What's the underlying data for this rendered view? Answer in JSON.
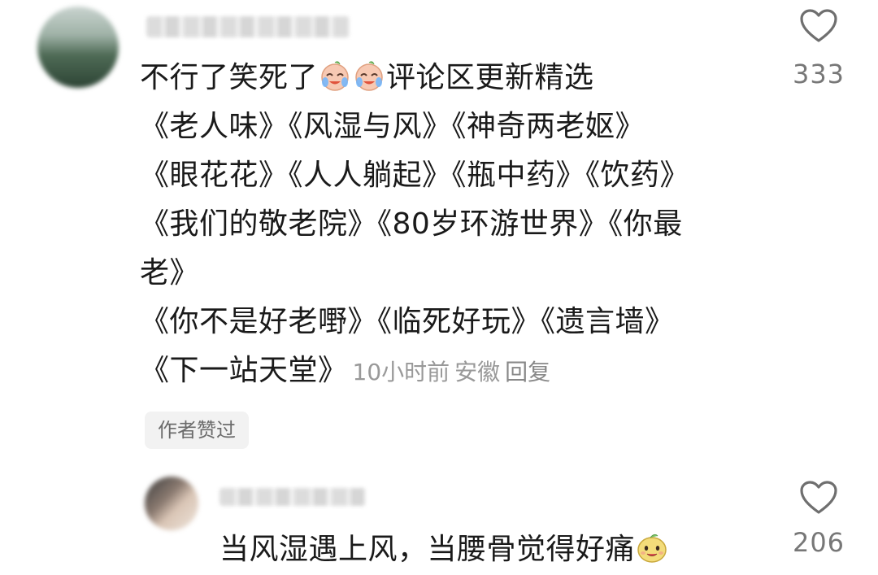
{
  "main_comment": {
    "username_blurred": "",
    "lines": [
      {
        "text": "不行了笑死了",
        "emoji": "crying-laughing-face-emoji",
        "tail": "评论区更新精选"
      },
      {
        "text": "《老人味》《风湿与风》《神奇两老妪》"
      },
      {
        "text": "《眼花花》《人人躺起》《瓶中药》《饮药》"
      },
      {
        "text": "《我们的敬老院》《80岁环游世界》《你最"
      },
      {
        "text": "老》"
      },
      {
        "text": "《你不是好老嘢》《临死好玩》《遗言墙》"
      },
      {
        "text": "《下一站天堂》"
      }
    ],
    "time": "10小时前",
    "location": "安徽",
    "reply_label": "回复",
    "author_liked_label": "作者赞过",
    "like_count": "333"
  },
  "reply_comment": {
    "text": "当风湿遇上风，当腰骨觉得好痛",
    "emoji": "smiling-bean-emoji",
    "like_count": "206"
  },
  "colors": {
    "text": "#1a1a1a",
    "meta": "#999999",
    "count": "#777777",
    "badge_bg": "#f2f2f2"
  },
  "icons": [
    "heart-outline-icon",
    "crying-laughing-face-emoji",
    "smiling-bean-emoji"
  ]
}
